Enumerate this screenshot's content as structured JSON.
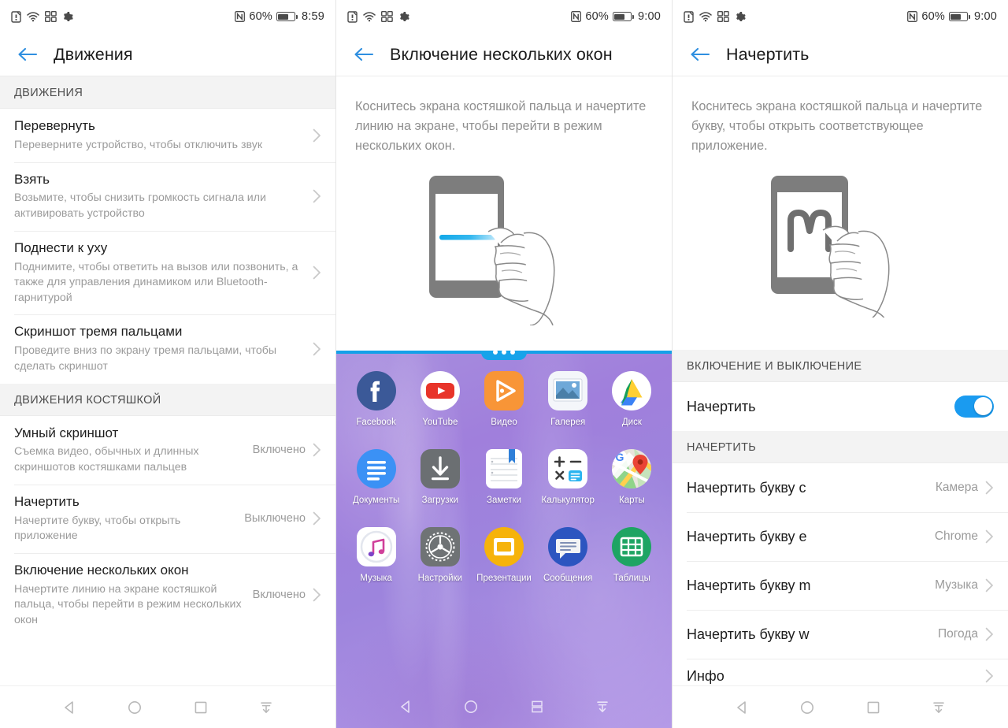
{
  "statusbar": {
    "icons": [
      "sim-card-icon",
      "wifi-icon",
      "qr-scan-icon",
      "gear-icon"
    ],
    "nfc_label": "N",
    "battery_percent": "60%",
    "time_left": "8:59",
    "time_mid": "9:00",
    "time_right": "9:00"
  },
  "navbar": {
    "back": "back-triangle-icon",
    "home": "home-circle-icon",
    "recents": "recents-square-icon",
    "dropdown": "navbar-hide-icon",
    "split": "split-screen-icon"
  },
  "panel1": {
    "title": "Движения",
    "back_icon": "back-arrow-icon",
    "sections": [
      {
        "header": "ДВИЖЕНИЯ",
        "rows": [
          {
            "title": "Перевернуть",
            "sub": "Переверните устройство, чтобы отключить звук",
            "value": ""
          },
          {
            "title": "Взять",
            "sub": "Возьмите, чтобы снизить громкость сигнала или активировать устройство",
            "value": ""
          },
          {
            "title": "Поднести к уху",
            "sub": "Поднимите, чтобы ответить на вызов или позвонить, а также для управления динамиком или Bluetooth-гарнитурой",
            "value": ""
          },
          {
            "title": "Скриншот тремя пальцами",
            "sub": "Проведите вниз по экрану тремя пальцами, чтобы сделать скриншот",
            "value": ""
          }
        ]
      },
      {
        "header": "ДВИЖЕНИЯ КОСТЯШКОЙ",
        "rows": [
          {
            "title": "Умный скриншот",
            "sub": "Съемка видео, обычных и длинных скриншотов костяшками пальцев",
            "value": "Включено"
          },
          {
            "title": "Начертить",
            "sub": "Начертите букву, чтобы открыть приложение",
            "value": "Выключено"
          },
          {
            "title": "Включение нескольких окон",
            "sub": "Начертите линию на экране костяшкой пальца, чтобы перейти в режим нескольких окон",
            "value": "Включено"
          }
        ]
      }
    ]
  },
  "panel2": {
    "title": "Включение нескольких окон",
    "back_icon": "back-arrow-icon",
    "description": "Коснитесь экрана костяшкой пальца и начертите линию на экране, чтобы перейти в режим нескольких окон.",
    "illustration": "knuckle-draw-line-illustration",
    "launcher": {
      "handle": "multiwindow-drag-handle",
      "apps": [
        {
          "label": "Facebook",
          "icon": "facebook-icon"
        },
        {
          "label": "YouTube",
          "icon": "youtube-icon"
        },
        {
          "label": "Видео",
          "icon": "video-icon"
        },
        {
          "label": "Галерея",
          "icon": "gallery-icon"
        },
        {
          "label": "Диск",
          "icon": "google-drive-icon"
        },
        {
          "label": "Документы",
          "icon": "google-docs-icon"
        },
        {
          "label": "Загрузки",
          "icon": "downloads-icon"
        },
        {
          "label": "Заметки",
          "icon": "notes-icon"
        },
        {
          "label": "Калькулятор",
          "icon": "calculator-icon"
        },
        {
          "label": "Карты",
          "icon": "google-maps-icon"
        },
        {
          "label": "Музыка",
          "icon": "music-icon"
        },
        {
          "label": "Настройки",
          "icon": "settings-gear-icon"
        },
        {
          "label": "Презентации",
          "icon": "google-slides-icon"
        },
        {
          "label": "Сообщения",
          "icon": "messages-icon"
        },
        {
          "label": "Таблицы",
          "icon": "google-sheets-icon"
        }
      ]
    }
  },
  "panel3": {
    "title": "Начертить",
    "back_icon": "back-arrow-icon",
    "description": "Коснитесь экрана костяшкой пальца и начертите букву, чтобы открыть соответствующее приложение.",
    "illustration": "knuckle-draw-letter-m-illustration",
    "sections": [
      {
        "header": "ВКЛЮЧЕНИЕ И ВЫКЛЮЧЕНИЕ",
        "rows": [
          {
            "title": "Начертить",
            "value": "",
            "toggle": true,
            "toggle_on": true
          }
        ]
      },
      {
        "header": "НАЧЕРТИТЬ",
        "rows": [
          {
            "title": "Начертить букву c",
            "value": "Камера"
          },
          {
            "title": "Начертить букву e",
            "value": "Chrome"
          },
          {
            "title": "Начертить букву m",
            "value": "Музыка"
          },
          {
            "title": "Начертить букву w",
            "value": "Погода"
          },
          {
            "title": "Инфо",
            "value": ""
          }
        ]
      }
    ]
  },
  "colors": {
    "accent_blue": "#1a9bf0",
    "back_arrow": "#2f8fe0",
    "section_bg": "#f3f3f3",
    "subtext": "#9b9b9b",
    "title_text": "#1d1d1d",
    "wallpaper_purple": "#a283dd"
  }
}
